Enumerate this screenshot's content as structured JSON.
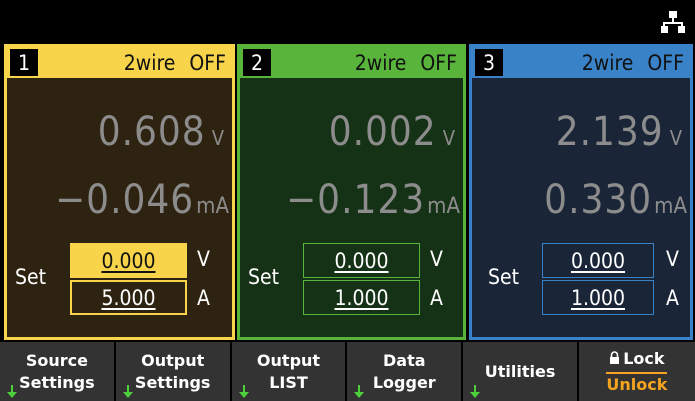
{
  "status_bar": {
    "network_icon": "network-lan-icon"
  },
  "channels": [
    {
      "number": "1",
      "mode": "2wire",
      "state": "OFF",
      "voltage": "0.608",
      "voltage_unit": "V",
      "current": "−0.046",
      "current_unit": "mA",
      "set_label": "Set",
      "set_voltage": "0.000",
      "set_voltage_unit": "V",
      "set_current": "5.000",
      "set_current_unit": "A",
      "color": "#f7d44a"
    },
    {
      "number": "2",
      "mode": "2wire",
      "state": "OFF",
      "voltage": "0.002",
      "voltage_unit": "V",
      "current": "−0.123",
      "current_unit": "mA",
      "set_label": "Set",
      "set_voltage": "0.000",
      "set_voltage_unit": "V",
      "set_current": "1.000",
      "set_current_unit": "A",
      "color": "#58b43a"
    },
    {
      "number": "3",
      "mode": "2wire",
      "state": "OFF",
      "voltage": "2.139",
      "voltage_unit": "V",
      "current": "0.330",
      "current_unit": "mA",
      "set_label": "Set",
      "set_voltage": "0.000",
      "set_voltage_unit": "V",
      "set_current": "1.000",
      "set_current_unit": "A",
      "color": "#3a82c8"
    }
  ],
  "softkeys": [
    {
      "line1": "Source",
      "line2": "Settings",
      "has_submenu": true
    },
    {
      "line1": "Output",
      "line2": "Settings",
      "has_submenu": true
    },
    {
      "line1": "Output",
      "line2": "LIST",
      "has_submenu": true
    },
    {
      "line1": "Data",
      "line2": "Logger",
      "has_submenu": true
    },
    {
      "line1": "Utilities",
      "line2": "",
      "has_submenu": true
    },
    {
      "line1": "Lock",
      "line2": "Unlock",
      "has_submenu": false,
      "icon": "lock-icon"
    }
  ]
}
